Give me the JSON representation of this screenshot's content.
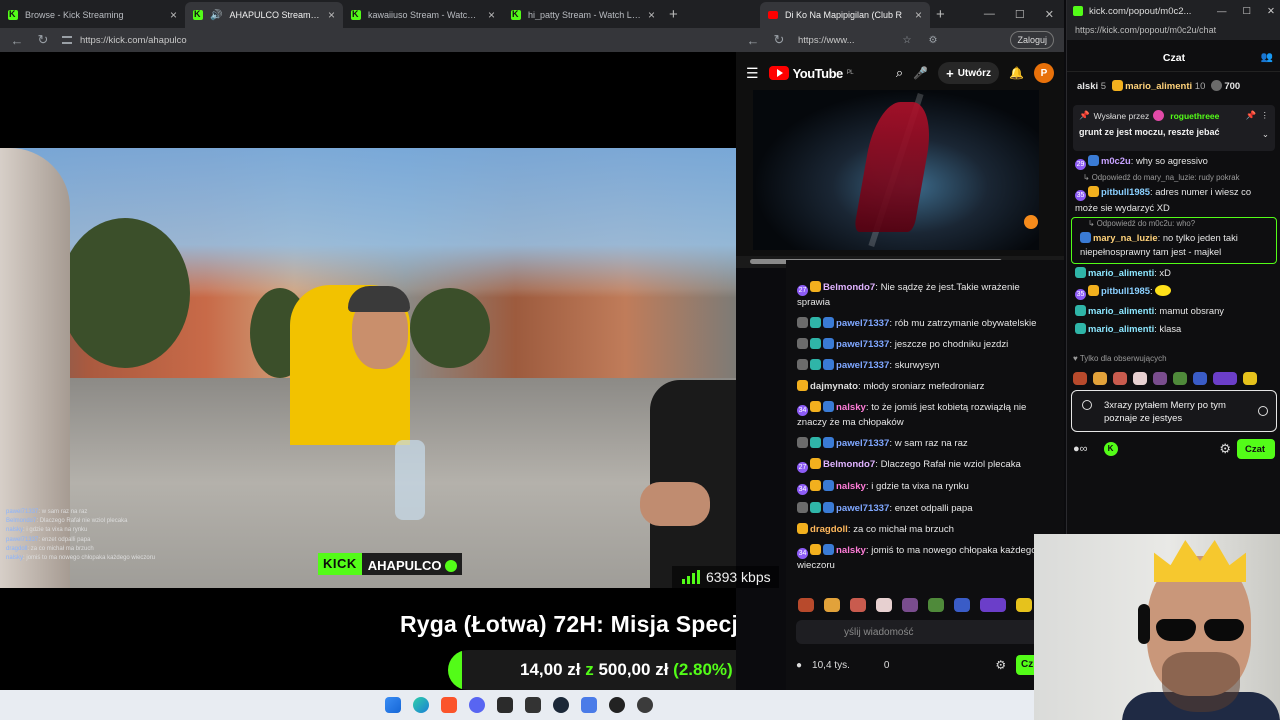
{
  "colors": {
    "kick_green": "#53fc18",
    "dark_bg": "#0e0e10",
    "yt_red": "#ff0000"
  },
  "browser1": {
    "tabs": [
      {
        "label": "Browse - Kick Streaming",
        "icon": "kick-favicon"
      },
      {
        "label": "AHAPULCO Stream - Watch Li",
        "icon": "kick-favicon",
        "active": true,
        "audio": true
      },
      {
        "label": "kawaiiuso Stream - Watch Live on",
        "icon": "kick-favicon"
      },
      {
        "label": "hi_patty Stream - Watch Live on K",
        "icon": "kick-favicon"
      }
    ],
    "url": "https://kick.com/ahapulco"
  },
  "video": {
    "kick_label": "KICK",
    "channel": "AHAPULCO",
    "bitrate": "6393 kbps",
    "overlay_chat": [
      {
        "user": "pawel71337",
        "text": "w sam raz na raz"
      },
      {
        "user": "Belmondo7",
        "text": "Dlaczego Rafał nie wziol plecaka"
      },
      {
        "user": "nalsky",
        "text": "i gdzie ta vixa na rynku"
      },
      {
        "user": "pawel71337",
        "text": "enzet odpalli papa"
      },
      {
        "user": "dragdoll",
        "text": "za co michał ma brzuch"
      },
      {
        "user": "nalsky",
        "text": "jomiś to ma nowego chłopaka każdego wieczoru"
      }
    ],
    "title": "Ryga (Łotwa) 72H: Misja Specjalna",
    "goal": {
      "current": "14,00 zł",
      "sep": "z",
      "target": "500,00 zł",
      "percent_label": "(2.80%)",
      "fraction": 0.028
    }
  },
  "browser2": {
    "tab": "Di Ko Na Mapipigilan (Club R",
    "url": "https://www...",
    "login_label": "Zaloguj",
    "yt_logo": "YouTube",
    "yt_region": "PL",
    "create_label": "Utwórz",
    "avatar_letter": "P"
  },
  "chat_mid": {
    "messages": [
      {
        "badges": [
          "num:27",
          "crown"
        ],
        "user": "Belmondo7",
        "cls": "u-belm",
        "text": "Nie sądzę że jest.Takie wrażenie sprawia"
      },
      {
        "badges": [
          "gray",
          "mod",
          "sub"
        ],
        "user": "pawel71337",
        "cls": "u-pawel",
        "text": "rób mu zatrzymanie obywatelskie"
      },
      {
        "badges": [
          "gray",
          "mod",
          "sub"
        ],
        "user": "pawel71337",
        "cls": "u-pawel",
        "text": "jeszcze po chodniku jezdzi"
      },
      {
        "badges": [
          "gray",
          "mod",
          "sub"
        ],
        "user": "pawel71337",
        "cls": "u-pawel",
        "text": "skurwysyn"
      },
      {
        "badges": [
          "crown"
        ],
        "user": "dajmynato",
        "cls": "u-daj",
        "text": "młody sroniarz mefedroniarz"
      },
      {
        "badges": [
          "num:34",
          "crown",
          "sub"
        ],
        "user": "nalsky",
        "cls": "u-nalsky",
        "text": "to że jomiś jest kobietą rozwiązłą nie znaczy że ma chłopaków"
      },
      {
        "badges": [
          "gray",
          "mod",
          "sub"
        ],
        "user": "pawel71337",
        "cls": "u-pawel",
        "text": "w sam raz na raz"
      },
      {
        "badges": [
          "num:27",
          "crown"
        ],
        "user": "Belmondo7",
        "cls": "u-belm",
        "text": "Dlaczego Rafał nie wziol plecaka"
      },
      {
        "badges": [
          "num:34",
          "crown",
          "sub"
        ],
        "user": "nalsky",
        "cls": "u-nalsky",
        "text": "i gdzie ta vixa na rynku"
      },
      {
        "badges": [
          "gray",
          "mod",
          "sub"
        ],
        "user": "pawel71337",
        "cls": "u-pawel",
        "text": "enzet odpalli papa"
      },
      {
        "badges": [
          "crown"
        ],
        "user": "dragdoll",
        "cls": "u-drag",
        "text": "za co michał ma brzuch"
      },
      {
        "badges": [
          "num:34",
          "crown",
          "sub"
        ],
        "user": "nalsky",
        "cls": "u-nalsky",
        "text": "jomiś to ma nowego chłopaka każdego wieczoru"
      }
    ],
    "input_placeholder": "yślij wiadomość",
    "viewers": "10,4 tys.",
    "points": "0",
    "send_label": "Cz"
  },
  "popout": {
    "window_title": "kick.com/popout/m0c2...",
    "url": "https://kick.com/popout/m0c2u/chat",
    "header": "Czat",
    "top_gifters": [
      {
        "name": "alski",
        "count": "5"
      },
      {
        "name": "mario_alimenti",
        "count": "10"
      },
      {
        "name": "",
        "count": "700"
      }
    ],
    "pinned_by_label": "Wysłane przez",
    "pinned_by_user": "roguethreee",
    "pinned_text": "grunt ze jest moczu, reszte jebać",
    "messages": [
      {
        "badges": [
          "num:29",
          "sub"
        ],
        "user": "m0c2u",
        "cls": "u-m0c",
        "text": "why so agressivo"
      },
      {
        "reply": "Odpowiedź do mary_na_luzie: rudy pokrak",
        "badges": [
          "num:35",
          "crown"
        ],
        "user": "pitbull1985",
        "cls": "u-pit",
        "text": "adres numer i wiesz co może sie wydarzyć XD"
      },
      {
        "reply": "Odpowiedź do m0c2u: who?",
        "badges": [
          "sub"
        ],
        "user": "mary_na_luzie",
        "cls": "u-mary",
        "text": "no tylko jeden taki niepełnosprawny tam jest - majkel",
        "highlight": true
      },
      {
        "badges": [
          "mod"
        ],
        "user": "mario_alimenti",
        "cls": "u-mario",
        "text": "xD"
      },
      {
        "badges": [
          "num:35",
          "crown"
        ],
        "user": "pitbull1985",
        "cls": "u-pit",
        "text": ""
      },
      {
        "badges": [
          "mod"
        ],
        "user": "mario_alimenti",
        "cls": "u-mario",
        "text": "mamut obsrany"
      },
      {
        "badges": [
          "mod"
        ],
        "user": "mario_alimenti",
        "cls": "u-mario",
        "text": "klasa"
      }
    ],
    "followers_only": "Tylko dla obserwujących",
    "input_text": "3xrazy pytałem Merry po tym poznaje ze jestyes",
    "send_label": "Czat"
  }
}
